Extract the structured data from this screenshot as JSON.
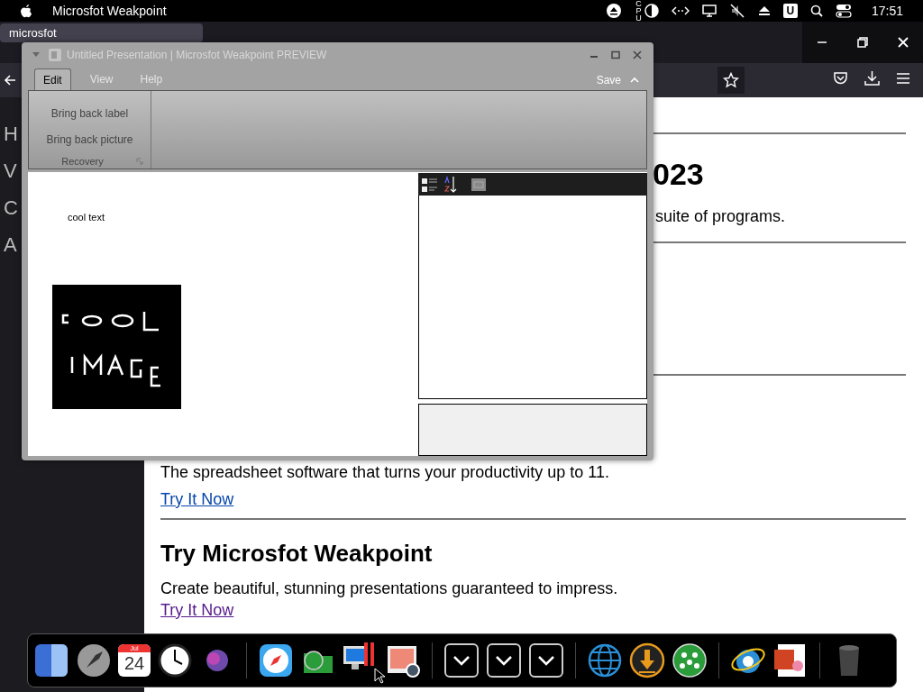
{
  "menu_bar": {
    "app_name": "Microsfot Weakpoint",
    "cpu_label": "CPU",
    "user_badge": "U",
    "clock": "17:51"
  },
  "browser": {
    "tabs": [
      {
        "label": "microsfot",
        "selected": true
      }
    ],
    "sidebar_letters": [
      "H",
      "V",
      "C",
      "A"
    ],
    "page": {
      "heading_fragment": "023",
      "text_fragment": "suite of programs.",
      "sections": [
        {
          "description": "The spreadsheet software that turns your productivity up to 11.",
          "link": "Try It Now"
        },
        {
          "title": "Try Microsfot Weakpoint",
          "description": "Create beautiful, stunning presentations guaranteed to impress.",
          "link": "Try It Now"
        }
      ]
    }
  },
  "app_window": {
    "title": "Untitled Presentation | Microsfot Weakpoint PREVIEW",
    "tabs": [
      {
        "label": "Edit",
        "selected": true
      },
      {
        "label": "View",
        "selected": false
      },
      {
        "label": "Help",
        "selected": false
      }
    ],
    "save": "Save",
    "ribbon_group": {
      "items": [
        "Bring back label",
        "Bring back picture"
      ],
      "name": "Recovery"
    },
    "canvas": {
      "label": "cool text"
    }
  },
  "dock": {
    "calendar": {
      "month": "Jul",
      "day": "24"
    }
  }
}
